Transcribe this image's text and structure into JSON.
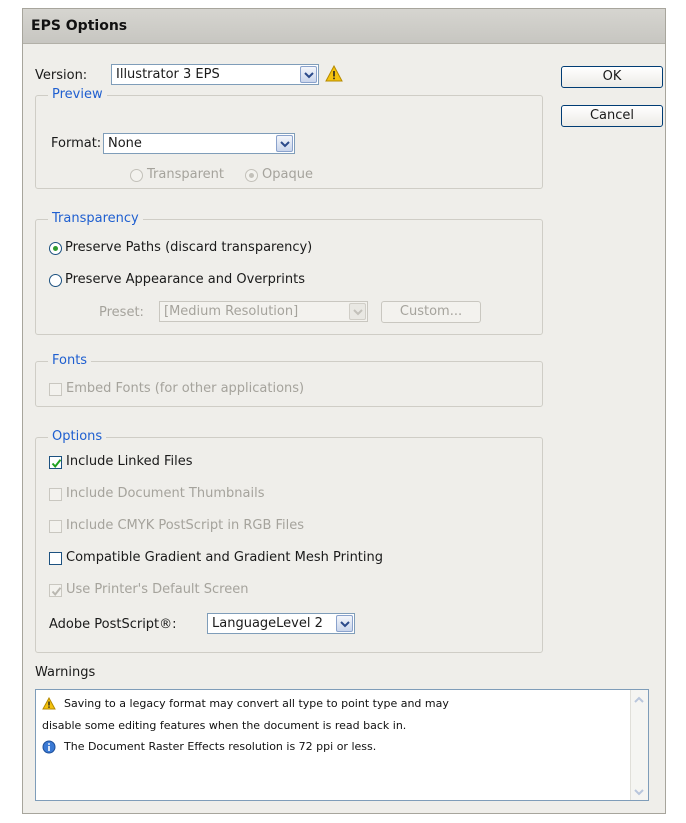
{
  "dialog": {
    "title": "EPS Options"
  },
  "version": {
    "label": "Version:",
    "value": "Illustrator 3 EPS"
  },
  "buttons": {
    "ok": "OK",
    "cancel": "Cancel"
  },
  "preview": {
    "legend": "Preview",
    "format_label": "Format:",
    "format_value": "None",
    "transparent": "Transparent",
    "opaque": "Opaque"
  },
  "transparency": {
    "legend": "Transparency",
    "preserve_paths": "Preserve Paths (discard transparency)",
    "preserve_appearance": "Preserve Appearance and Overprints",
    "preset_label": "Preset:",
    "preset_value": "[Medium Resolution]",
    "custom": "Custom..."
  },
  "fonts": {
    "legend": "Fonts",
    "embed": "Embed Fonts (for other applications)"
  },
  "options": {
    "legend": "Options",
    "include_linked": "Include Linked Files",
    "include_thumbnails": "Include Document Thumbnails",
    "include_cmyk": "Include CMYK PostScript in RGB Files",
    "compatible_gradient": "Compatible Gradient and Gradient Mesh Printing",
    "use_printer_screen": "Use Printer's Default Screen",
    "postscript_label": "Adobe PostScript®:",
    "postscript_value": "LanguageLevel 2"
  },
  "warnings": {
    "label": "Warnings",
    "line1": "Saving to a legacy format may convert all type to point type and may",
    "line2": "disable some editing features when the document is read back in.",
    "line3": "The Document Raster Effects resolution is 72 ppi or less."
  }
}
